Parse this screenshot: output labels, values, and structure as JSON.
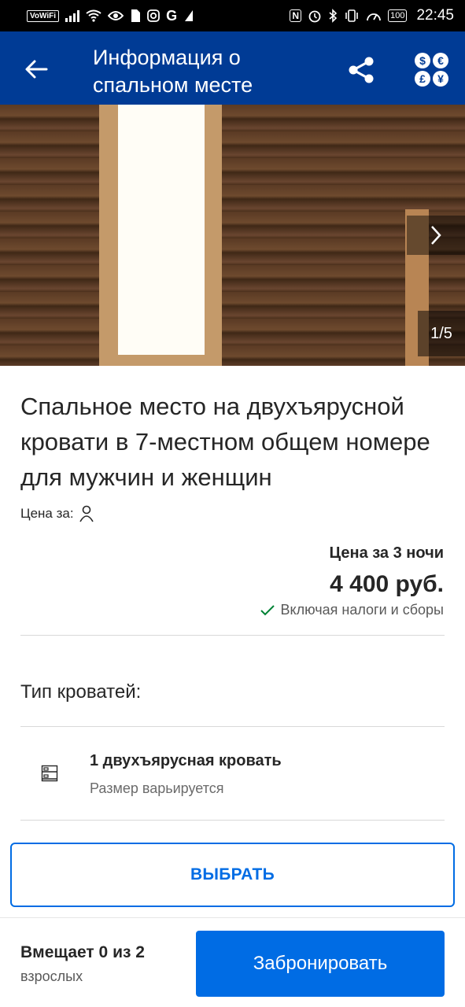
{
  "status_bar": {
    "vowifi": "VoWiFi",
    "battery": "100",
    "time": "22:45",
    "icons": [
      "signal-icon",
      "wifi-icon",
      "eye-icon",
      "sim-icon",
      "instagram-icon",
      "google-icon",
      "app-icon",
      "nfc-icon",
      "alarm-icon",
      "bluetooth-icon",
      "vibrate-icon",
      "speed-icon",
      "battery-icon"
    ]
  },
  "header": {
    "title": "Информация о спальном месте",
    "back_icon": "arrow-left-icon",
    "share_icon": "share-icon",
    "currency_icon": "currency-icon",
    "currency_symbols": [
      "$",
      "€",
      "£",
      "¥"
    ],
    "background": "#003b95"
  },
  "gallery": {
    "counter": "1/5",
    "next_icon": "chevron-right-icon"
  },
  "room": {
    "title": "Спальное место на двухъярусной кровати в 7-местном общем номере для мужчин и женщин",
    "price_for_label": "Цена за:",
    "person_icon": "person-icon"
  },
  "price": {
    "label": "Цена за 3 ночи",
    "value": "4 400 руб.",
    "taxes": "Включая налоги и сборы",
    "check_color": "#008234"
  },
  "beds": {
    "label": "Тип кроватей:",
    "items": [
      {
        "name": "1 двухъярусная кровать",
        "size": "Размер варьируется",
        "icon": "bunk-bed-icon"
      }
    ]
  },
  "actions": {
    "select_label": "ВЫБРАТЬ",
    "book_label": "Забронировать",
    "accent": "#006ce4"
  },
  "capacity": {
    "title": "Вмещает 0 из 2",
    "subtitle": "взрослых"
  }
}
